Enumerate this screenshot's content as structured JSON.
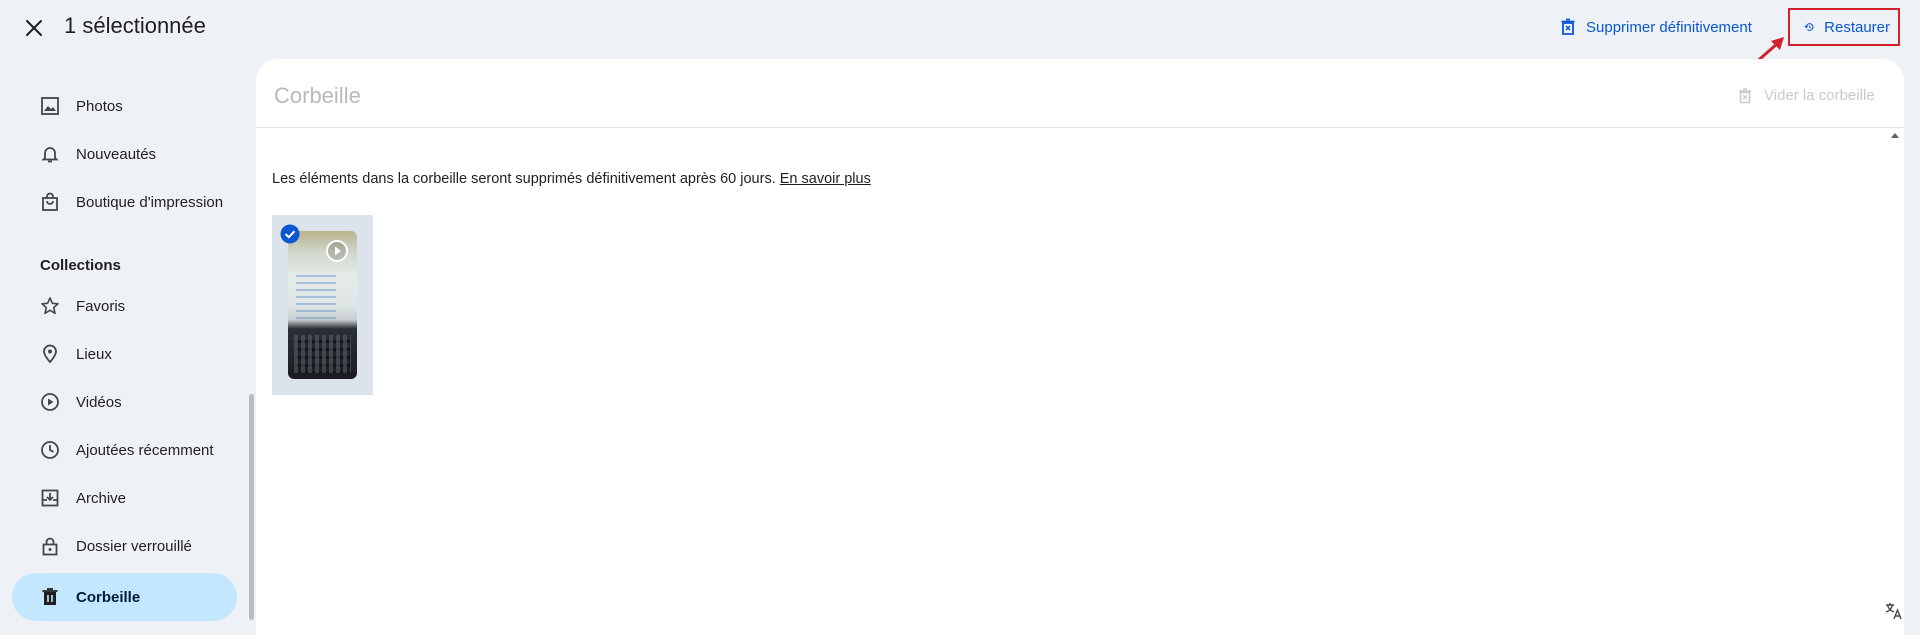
{
  "topbar": {
    "selection_title": "1 sélectionnée",
    "delete_label": "Supprimer définitivement",
    "restore_label": "Restaurer"
  },
  "sidebar": {
    "items_top": [
      {
        "label": "Photos",
        "icon": "photo-icon"
      },
      {
        "label": "Nouveautés",
        "icon": "bell-icon"
      },
      {
        "label": "Boutique d'impression",
        "icon": "shopping-bag-icon"
      }
    ],
    "collections_label": "Collections",
    "items_collections": [
      {
        "label": "Favoris",
        "icon": "star-icon"
      },
      {
        "label": "Lieux",
        "icon": "location-pin-icon"
      },
      {
        "label": "Vidéos",
        "icon": "play-circle-icon"
      },
      {
        "label": "Ajoutées récemment",
        "icon": "clock-icon"
      },
      {
        "label": "Archive",
        "icon": "archive-icon"
      },
      {
        "label": "Dossier verrouillé",
        "icon": "lock-icon"
      },
      {
        "label": "Corbeille",
        "icon": "trash-icon",
        "active": true
      }
    ]
  },
  "main": {
    "title": "Corbeille",
    "empty_trash_label": "Vider la corbeille",
    "info_text": "Les éléments dans la corbeille seront supprimés définitivement après 60 jours.",
    "learn_more": "En savoir plus"
  },
  "colors": {
    "accent": "#0b57d0",
    "active_nav": "#c2e7ff",
    "annotation_red": "#d3202b",
    "background": "#eef1f6"
  }
}
